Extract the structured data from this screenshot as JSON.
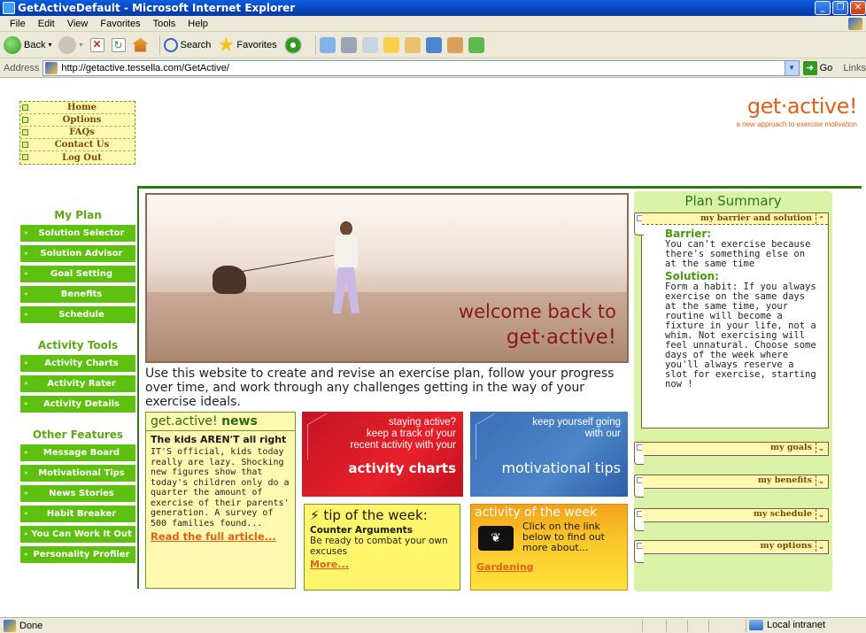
{
  "window": {
    "title": "GetActiveDefault - Microsoft Internet Explorer",
    "buttons": [
      "_",
      "❐",
      "✕"
    ]
  },
  "menubar": [
    "File",
    "Edit",
    "View",
    "Favorites",
    "Tools",
    "Help"
  ],
  "toolbar": {
    "back_label": "Back",
    "search_label": "Search",
    "favorites_label": "Favorites"
  },
  "addressbar": {
    "label": "Address",
    "url": "http://getactive.tessella.com/GetActive/",
    "go_label": "Go",
    "links_label": "Links"
  },
  "topnav": [
    "Home",
    "Options",
    "FAQs",
    "Contact Us",
    "Log Out"
  ],
  "logo": {
    "title": "get·active!",
    "tagline": "a new approach to exercise motivation"
  },
  "sidebar": {
    "my_plan": {
      "heading": "My Plan",
      "items": [
        "Solution Selector",
        "Solution Advisor",
        "Goal Setting",
        "Benefits",
        "Schedule"
      ]
    },
    "activity_tools": {
      "heading": "Activity Tools",
      "items": [
        "Activity Charts",
        "Activity Rater",
        "Activity Details"
      ]
    },
    "other_features": {
      "heading": "Other Features",
      "items": [
        "Message Board",
        "Motivational Tips",
        "News Stories",
        "Habit Breaker",
        "You Can Work It Out",
        "Personality Profiler"
      ]
    }
  },
  "hero": {
    "line1": "welcome back to",
    "line2": "get·active!"
  },
  "intro": "Use this website to create and revise an exercise plan, follow your progress over time, and work through any challenges getting in the way of your exercise ideals.",
  "news": {
    "title_prefix": "get.active!",
    "title_suffix": "news",
    "headline": "The kids AREN'T all right",
    "body": "IT'S official, kids today really are lazy. Shocking new figures show that today's children only do a quarter the amount of exercise of their parents' generation. A survey of 500 families found...",
    "link": "Read the full article..."
  },
  "promo_charts": {
    "line1": "staying active?",
    "line2": "keep a track of your",
    "line3": "recent activity with your",
    "big": "activity charts"
  },
  "promo_tips": {
    "line1": "keep yourself going",
    "line2": "with our",
    "big": "motivational tips"
  },
  "tip": {
    "title": "tip of the week:",
    "subtitle": "Counter Arguments",
    "body": "Be ready to combat your own excuses",
    "link": "More..."
  },
  "activity": {
    "title": "activity of the week",
    "body": "Click on the link below to find out more about...",
    "link": "Gardening"
  },
  "summary": {
    "title": "Plan Summary",
    "barrier_card": {
      "header": "my barrier and solution",
      "barrier_label": "Barrier:",
      "barrier_text": "You can't exercise because there's something else on at the same time",
      "solution_label": "Solution:",
      "solution_text": "Form a habit: If you always exercise on the same days at the same time, your routine will become a fixture in your life, not a whim. Not exercising will feel unnatural. Choose some days of the week where you'll always reserve a slot for exercise, starting now !"
    },
    "goals_header": "my goals",
    "benefits_header": "my benefits",
    "schedule_header": "my schedule",
    "options_header": "my options"
  },
  "statusbar": {
    "status": "Done",
    "zone": "Local intranet"
  }
}
